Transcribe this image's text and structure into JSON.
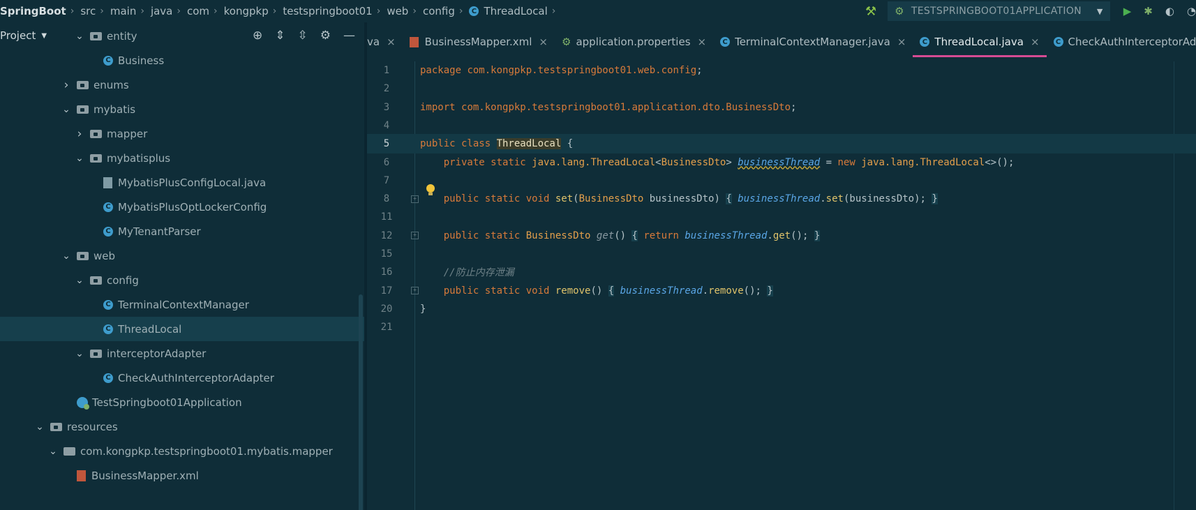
{
  "breadcrumb": {
    "items": [
      "SpringBoot",
      "src",
      "main",
      "java",
      "com",
      "kongpkp",
      "testspringboot01",
      "web",
      "config"
    ],
    "current": "ThreadLocal",
    "separator": "›"
  },
  "toolbar": {
    "run_config": "TESTSPRINGBOOT01APPLICATION"
  },
  "project_panel": {
    "title": "Project",
    "tree": [
      {
        "label": "entity",
        "kind": "folder",
        "expanded": true,
        "depth": 3
      },
      {
        "label": "Business",
        "kind": "class",
        "depth": 4
      },
      {
        "label": "enums",
        "kind": "folder",
        "expanded": false,
        "depth": 2
      },
      {
        "label": "mybatis",
        "kind": "folder",
        "expanded": true,
        "depth": 2
      },
      {
        "label": "mapper",
        "kind": "folder",
        "expanded": false,
        "depth": 3
      },
      {
        "label": "mybatisplus",
        "kind": "folder",
        "expanded": true,
        "depth": 3
      },
      {
        "label": "MybatisPlusConfigLocal.java",
        "kind": "javafile",
        "depth": 4
      },
      {
        "label": "MybatisPlusOptLockerConfig",
        "kind": "class",
        "depth": 4
      },
      {
        "label": "MyTenantParser",
        "kind": "class",
        "depth": 4
      },
      {
        "label": "web",
        "kind": "folder",
        "expanded": true,
        "depth": 2
      },
      {
        "label": "config",
        "kind": "folder",
        "expanded": true,
        "depth": 3
      },
      {
        "label": "TerminalContextManager",
        "kind": "class",
        "depth": 4
      },
      {
        "label": "ThreadLocal",
        "kind": "class",
        "depth": 4,
        "selected": true
      },
      {
        "label": "interceptorAdapter",
        "kind": "folder",
        "expanded": true,
        "depth": 3
      },
      {
        "label": "CheckAuthInterceptorAdapter",
        "kind": "class",
        "depth": 4
      },
      {
        "label": "TestSpringboot01Application",
        "kind": "app",
        "depth": 2
      },
      {
        "label": "resources",
        "kind": "resfolder",
        "expanded": true,
        "depth": 0
      },
      {
        "label": "com.kongpkp.testspringboot01.mybatis.mapper",
        "kind": "plainfolder",
        "expanded": true,
        "depth": 1
      },
      {
        "label": "BusinessMapper.xml",
        "kind": "xml",
        "depth": 2
      }
    ]
  },
  "tabs": [
    {
      "label": "va",
      "kind": "partial",
      "active": false
    },
    {
      "label": "BusinessMapper.xml",
      "kind": "xml",
      "active": false
    },
    {
      "label": "application.properties",
      "kind": "props",
      "active": false
    },
    {
      "label": "TerminalContextManager.java",
      "kind": "class",
      "active": false
    },
    {
      "label": "ThreadLocal.java",
      "kind": "class",
      "active": true
    },
    {
      "label": "CheckAuthInterceptorAdapt",
      "kind": "class",
      "active": false
    }
  ],
  "editor": {
    "current_line": 5,
    "lines": [
      {
        "n": "1",
        "tokens": [
          [
            "kw",
            "package "
          ],
          [
            "pkg",
            "com.kongpkp.testspringboot01.web.config"
          ],
          [
            "txt",
            ";"
          ]
        ]
      },
      {
        "n": "2",
        "tokens": []
      },
      {
        "n": "3",
        "tokens": [
          [
            "kw",
            "import "
          ],
          [
            "pkg",
            "com.kongpkp.testspringboot01.application.dto.BusinessDto"
          ],
          [
            "txt",
            ";"
          ]
        ]
      },
      {
        "n": "4",
        "tokens": []
      },
      {
        "n": "5",
        "tokens": [
          [
            "kw",
            "public class "
          ],
          [
            "hl",
            "ThreadLocal"
          ],
          [
            "txt",
            " {"
          ]
        ]
      },
      {
        "n": "6",
        "tokens": [
          [
            "txt",
            "    "
          ],
          [
            "kw",
            "private static "
          ],
          [
            "cls",
            "java.lang.ThreadLocal"
          ],
          [
            "txt",
            "<"
          ],
          [
            "cls",
            "BusinessDto"
          ],
          [
            "txt",
            "> "
          ],
          [
            "fld-u",
            "businessThread"
          ],
          [
            "txt",
            " = "
          ],
          [
            "kw",
            "new "
          ],
          [
            "cls",
            "java.lang.ThreadLocal"
          ],
          [
            "txt",
            "<>();"
          ]
        ]
      },
      {
        "n": "7",
        "tokens": []
      },
      {
        "n": "8",
        "fold": true,
        "tokens": [
          [
            "txt",
            "    "
          ],
          [
            "kw",
            "public static void "
          ],
          [
            "mth",
            "set"
          ],
          [
            "txt",
            "("
          ],
          [
            "cls",
            "BusinessDto"
          ],
          [
            "txt",
            " businessDto) "
          ],
          [
            "brace-box",
            "{"
          ],
          [
            "txt",
            " "
          ],
          [
            "fld",
            "businessThread"
          ],
          [
            "txt",
            "."
          ],
          [
            "mth",
            "set"
          ],
          [
            "txt",
            "(businessDto); "
          ],
          [
            "brace-box",
            "}"
          ]
        ]
      },
      {
        "n": "11",
        "tokens": []
      },
      {
        "n": "12",
        "fold": true,
        "tokens": [
          [
            "txt",
            "    "
          ],
          [
            "kw",
            "public static "
          ],
          [
            "cls",
            "BusinessDto "
          ],
          [
            "mth-i",
            "get"
          ],
          [
            "txt",
            "() "
          ],
          [
            "brace-box",
            "{"
          ],
          [
            "txt",
            " "
          ],
          [
            "kw",
            "return "
          ],
          [
            "fld",
            "businessThread"
          ],
          [
            "txt",
            "."
          ],
          [
            "mth",
            "get"
          ],
          [
            "txt",
            "(); "
          ],
          [
            "brace-box",
            "}"
          ]
        ]
      },
      {
        "n": "15",
        "tokens": []
      },
      {
        "n": "16",
        "tokens": [
          [
            "txt",
            "    "
          ],
          [
            "cmt",
            "//防止内存泄漏"
          ]
        ]
      },
      {
        "n": "17",
        "fold": true,
        "tokens": [
          [
            "txt",
            "    "
          ],
          [
            "kw",
            "public static void "
          ],
          [
            "mth",
            "remove"
          ],
          [
            "txt",
            "() "
          ],
          [
            "brace-box",
            "{"
          ],
          [
            "txt",
            " "
          ],
          [
            "fld",
            "businessThread"
          ],
          [
            "txt",
            "."
          ],
          [
            "mth",
            "remove"
          ],
          [
            "txt",
            "(); "
          ],
          [
            "brace-box",
            "}"
          ]
        ]
      },
      {
        "n": "20",
        "tokens": [
          [
            "txt",
            "}"
          ]
        ]
      },
      {
        "n": "21",
        "tokens": []
      }
    ]
  }
}
